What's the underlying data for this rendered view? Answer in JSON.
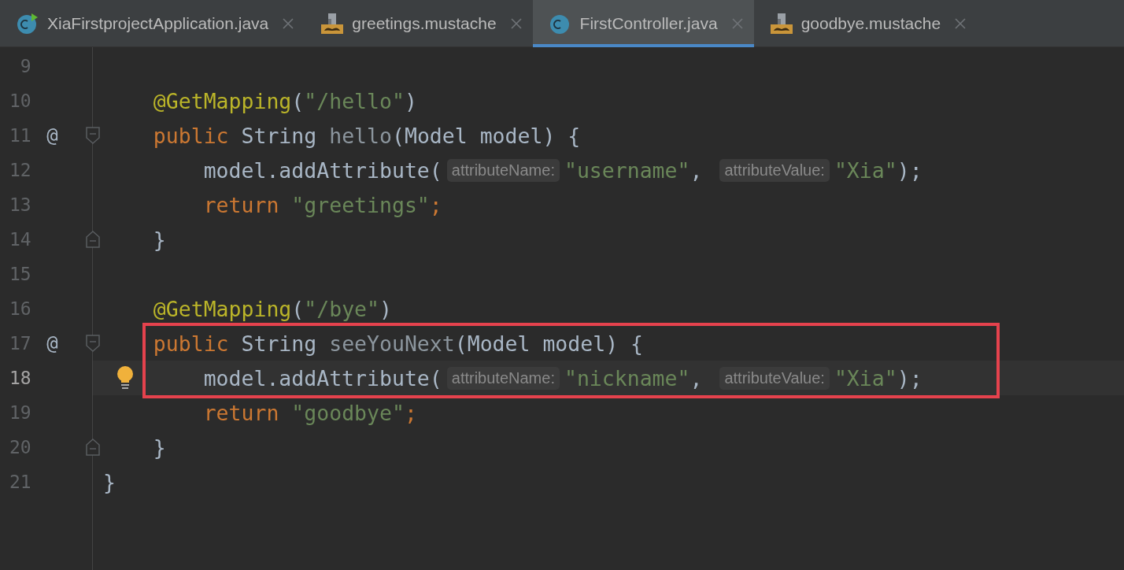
{
  "tabs": [
    {
      "label": "XiaFirstprojectApplication.java",
      "kind": "class-run",
      "selected": false
    },
    {
      "label": "greetings.mustache",
      "kind": "mustache",
      "selected": false
    },
    {
      "label": "FirstController.java",
      "kind": "class",
      "selected": true
    },
    {
      "label": "goodbye.mustache",
      "kind": "mustache",
      "selected": false
    }
  ],
  "class_body": [
    {
      "number": "9",
      "current": false,
      "boxed": false
    },
    {
      "number": "10",
      "current": false,
      "boxed": false,
      "tokens": [
        {
          "kind": "annotation",
          "text": "@GetMapping"
        },
        {
          "kind": "plain",
          "text": "("
        },
        {
          "kind": "string",
          "text": "\"/hello\""
        },
        {
          "kind": "plain",
          "text": ")"
        }
      ]
    },
    {
      "number": "11",
      "kind": "fold-start",
      "mark": "@",
      "current": false,
      "boxed": false,
      "tokens": [
        {
          "kind": "keyword",
          "text": "public "
        },
        {
          "kind": "plain",
          "text": "String "
        },
        {
          "kind": "unused",
          "text": "hello"
        },
        {
          "kind": "plain",
          "text": "(Model model) {"
        }
      ],
      "children": [
        {
          "number": "12",
          "current": false,
          "boxed": false,
          "tokens": [
            {
              "kind": "plain",
              "text": "model.addAttribute("
            },
            {
              "kind": "hint",
              "text": "attributeName:"
            },
            {
              "kind": "string",
              "text": "\"username\""
            },
            {
              "kind": "plain",
              "text": ", "
            },
            {
              "kind": "hint",
              "text": "attributeValue:"
            },
            {
              "kind": "string",
              "text": "\"Xia\""
            },
            {
              "kind": "plain",
              "text": ");"
            }
          ]
        },
        {
          "number": "13",
          "current": false,
          "boxed": false,
          "tokens": [
            {
              "kind": "keyword",
              "text": "return "
            },
            {
              "kind": "string",
              "text": "\"greetings\""
            },
            {
              "kind": "keyword",
              "text": ";"
            }
          ]
        }
      ]
    },
    {
      "number": "14",
      "kind": "fold-end",
      "current": false,
      "boxed": false,
      "tokens": [
        {
          "kind": "plain",
          "text": "}"
        }
      ]
    },
    {
      "number": "15",
      "current": false,
      "boxed": false
    },
    {
      "number": "16",
      "current": false,
      "boxed": false,
      "tokens": [
        {
          "kind": "annotation",
          "text": "@GetMapping"
        },
        {
          "kind": "plain",
          "text": "("
        },
        {
          "kind": "string",
          "text": "\"/bye\""
        },
        {
          "kind": "plain",
          "text": ")"
        }
      ]
    },
    {
      "number": "17",
      "kind": "fold-start",
      "mark": "@",
      "current": false,
      "boxed": true,
      "tokens": [
        {
          "kind": "keyword",
          "text": "public "
        },
        {
          "kind": "plain",
          "text": "String "
        },
        {
          "kind": "unused",
          "text": "seeYouNext"
        },
        {
          "kind": "plain",
          "text": "(Model model) {"
        }
      ],
      "children": [
        {
          "number": "18",
          "current": true,
          "bulb": true,
          "boxed": true,
          "tokens": [
            {
              "kind": "plain",
              "text": "model.addAttribute("
            },
            {
              "kind": "hint",
              "text": "attributeName:"
            },
            {
              "kind": "string",
              "text": "\"nickname\""
            },
            {
              "kind": "plain",
              "text": ", "
            },
            {
              "kind": "hint",
              "text": "attributeValue:"
            },
            {
              "kind": "string",
              "text": "\"Xia\""
            },
            {
              "kind": "plain",
              "text": ");"
            }
          ]
        },
        {
          "number": "19",
          "current": false,
          "boxed": false,
          "tokens": [
            {
              "kind": "keyword",
              "text": "return "
            },
            {
              "kind": "string",
              "text": "\"goodbye\""
            },
            {
              "kind": "keyword",
              "text": ";"
            }
          ]
        }
      ]
    },
    {
      "number": "20",
      "kind": "fold-end",
      "current": false,
      "boxed": false,
      "tokens": [
        {
          "kind": "plain",
          "text": "}"
        }
      ]
    }
  ],
  "closing_line": {
    "number": "21",
    "current": false,
    "boxed": false,
    "tokens": [
      {
        "kind": "plain",
        "text": "}"
      }
    ]
  }
}
